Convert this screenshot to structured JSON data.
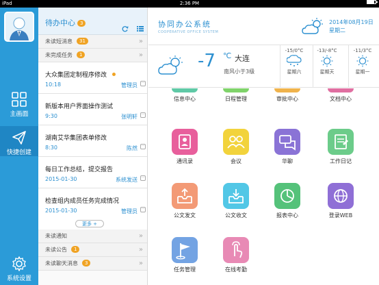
{
  "statusbar": {
    "carrier": "iPad",
    "time": "2:36 PM"
  },
  "nav": {
    "items": [
      {
        "label": "主画面",
        "icon": "grid-icon"
      },
      {
        "label": "快捷创建",
        "icon": "paper-plane-icon"
      },
      {
        "label": "系统设置",
        "icon": "gear-icon"
      }
    ]
  },
  "todo": {
    "title": "待办中心",
    "count": "3",
    "sections": {
      "unread_sms": {
        "label": "未读短消息",
        "count": "31"
      },
      "unfinished": {
        "label": "未完成任务",
        "count": "1"
      },
      "unread_notice": {
        "label": "未读通知"
      },
      "unread_announce": {
        "label": "未读公告",
        "count": "1"
      },
      "unread_chat": {
        "label": "未读聊天消息",
        "count": "3"
      }
    },
    "tasks": [
      {
        "title": "大众集团定制程序修改",
        "date": "10:18",
        "user": "管理员"
      },
      {
        "title": "新版本用户界面操作测试",
        "date": "9:30",
        "user": "张明轩"
      },
      {
        "title": "湖南艾华集团表单修改",
        "date": "8:30",
        "user": "陈然"
      },
      {
        "title": "每日工作总结，提交报告",
        "date": "2015-01-30",
        "user": "系统发送"
      },
      {
        "title": "检查组内成员任务完成情况",
        "date": "2015-01-30",
        "user": "管理员"
      }
    ],
    "more_label": "更多 +"
  },
  "header": {
    "title": "协同办公系统",
    "subtitle": "COOPERATIVE OFFICE SYSTEM",
    "date": "2014年08月19日",
    "weekday": "星期二"
  },
  "weather": {
    "temp": "-7",
    "unit": "℃",
    "city": "大连",
    "wind": "南风小于3级",
    "forecast": [
      {
        "range": "-15/0°C",
        "day": "星期六",
        "icon": "snow-cloud-icon"
      },
      {
        "range": "-13/-8°C",
        "day": "星期天",
        "icon": "sun-icon"
      },
      {
        "range": "-11/3°C",
        "day": "星期一",
        "icon": "sun-icon"
      }
    ]
  },
  "apps": [
    {
      "label": "信息中心",
      "color": "#5fc9a6"
    },
    {
      "label": "日程管理",
      "color": "#7fd36a"
    },
    {
      "label": "审批中心",
      "color": "#f0b34c"
    },
    {
      "label": "文档中心",
      "color": "#e06fa1"
    },
    {
      "label": "通讯录",
      "color": "#e85f9c"
    },
    {
      "label": "会议",
      "color": "#f2d33c"
    },
    {
      "label": "华聊",
      "color": "#8a73d6"
    },
    {
      "label": "工作日记",
      "color": "#6ccc8a"
    },
    {
      "label": "公文发文",
      "color": "#f39a76"
    },
    {
      "label": "公文收文",
      "color": "#52c7e6"
    },
    {
      "label": "报表中心",
      "color": "#55c27a"
    },
    {
      "label": "登录WEB",
      "color": "#8f6fd6"
    },
    {
      "label": "任务管理",
      "color": "#73a3e3"
    },
    {
      "label": "在线考勤",
      "color": "#e88ab5"
    }
  ]
}
